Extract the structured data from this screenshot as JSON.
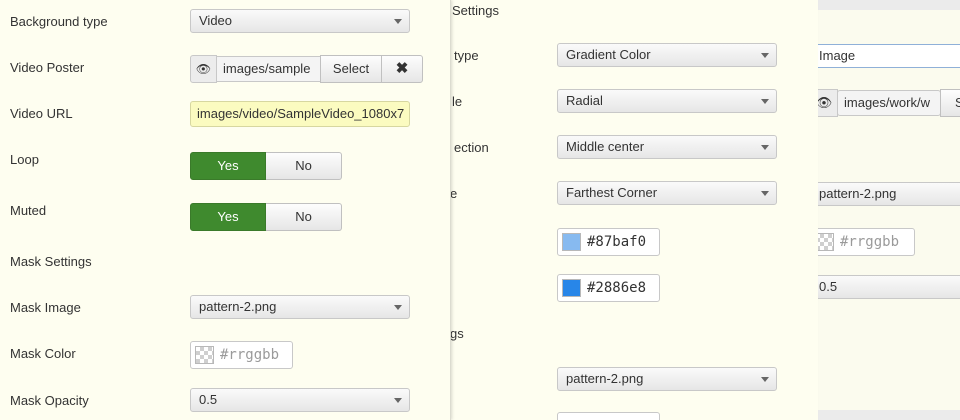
{
  "right_panel": {
    "image_select": "Image",
    "poster_path": "images/work/w",
    "poster_select_partial": "S",
    "mask_image": "pattern-2.png",
    "mask_color_placeholder": "#rrggbb",
    "mask_opacity": "0.5"
  },
  "middle_panel": {
    "section_title": "Settings",
    "labels": {
      "type": "type",
      "style": "le",
      "direction": "ection",
      "size": "e",
      "mask_section": "gs"
    },
    "gradient_type": "Gradient Color",
    "gradient_style": "Radial",
    "gradient_direction": "Middle center",
    "gradient_size": "Farthest Corner",
    "color1": {
      "value": "#87baf0",
      "color": "#87baf0"
    },
    "color2": {
      "value": "#2886e8",
      "color": "#2886e8"
    },
    "mask_image": "pattern-2.png"
  },
  "left_panel": {
    "labels": {
      "background_type": "Background type",
      "video_poster": "Video Poster",
      "video_url": "Video URL",
      "loop": "Loop",
      "muted": "Muted",
      "mask_settings": "Mask Settings",
      "mask_image": "Mask Image",
      "mask_color": "Mask Color",
      "mask_opacity": "Mask Opacity"
    },
    "background_type": "Video",
    "video_poster_path": "images/sample",
    "select_button": "Select",
    "clear_button": "✖",
    "video_url": "images/video/SampleVideo_1080x7",
    "loop": {
      "yes": "Yes",
      "no": "No",
      "selected": "Yes"
    },
    "muted": {
      "yes": "Yes",
      "no": "No",
      "selected": "Yes"
    },
    "mask_image": "pattern-2.png",
    "mask_color_placeholder": "#rrggbb",
    "mask_opacity": "0.5"
  }
}
